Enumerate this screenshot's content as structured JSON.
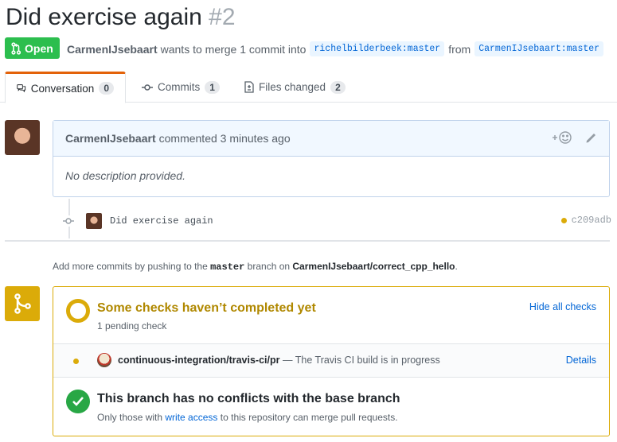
{
  "pr": {
    "title": "Did exercise again",
    "number": "#2",
    "state": "Open",
    "author": "CarmenIJsebaart",
    "meta_text": "wants to merge 1 commit into",
    "base_ref": "richelbilderbeek:master",
    "from_text": "from",
    "head_ref": "CarmenIJsebaart:master"
  },
  "tabs": [
    {
      "label": "Conversation",
      "count": "0"
    },
    {
      "label": "Commits",
      "count": "1"
    },
    {
      "label": "Files changed",
      "count": "2"
    }
  ],
  "comment": {
    "author": "CarmenIJsebaart",
    "action": "commented 3 minutes ago",
    "body": "No description provided."
  },
  "commit": {
    "message": "Did exercise again",
    "sha": "c209adb"
  },
  "push_hint": {
    "prefix": "Add more commits by pushing to the",
    "branch": "master",
    "middle": "branch on",
    "repo": "CarmenIJsebaart/correct_cpp_hello",
    "suffix": "."
  },
  "checks": {
    "title": "Some checks haven’t completed yet",
    "subtitle": "1 pending check",
    "toggle_label": "Hide all checks",
    "status": {
      "context": "continuous-integration/travis-ci/pr",
      "description": "— The Travis CI build is in progress",
      "details_label": "Details"
    }
  },
  "merge": {
    "title": "This branch has no conflicts with the base branch",
    "sub_prefix": "Only those with",
    "sub_link": "write access",
    "sub_suffix": "to this repository can merge pull requests."
  },
  "colors": {
    "open_green": "#2cbe4e",
    "pending_yellow": "#dbab09",
    "link_blue": "#0366d6",
    "success_green": "#28a745"
  }
}
